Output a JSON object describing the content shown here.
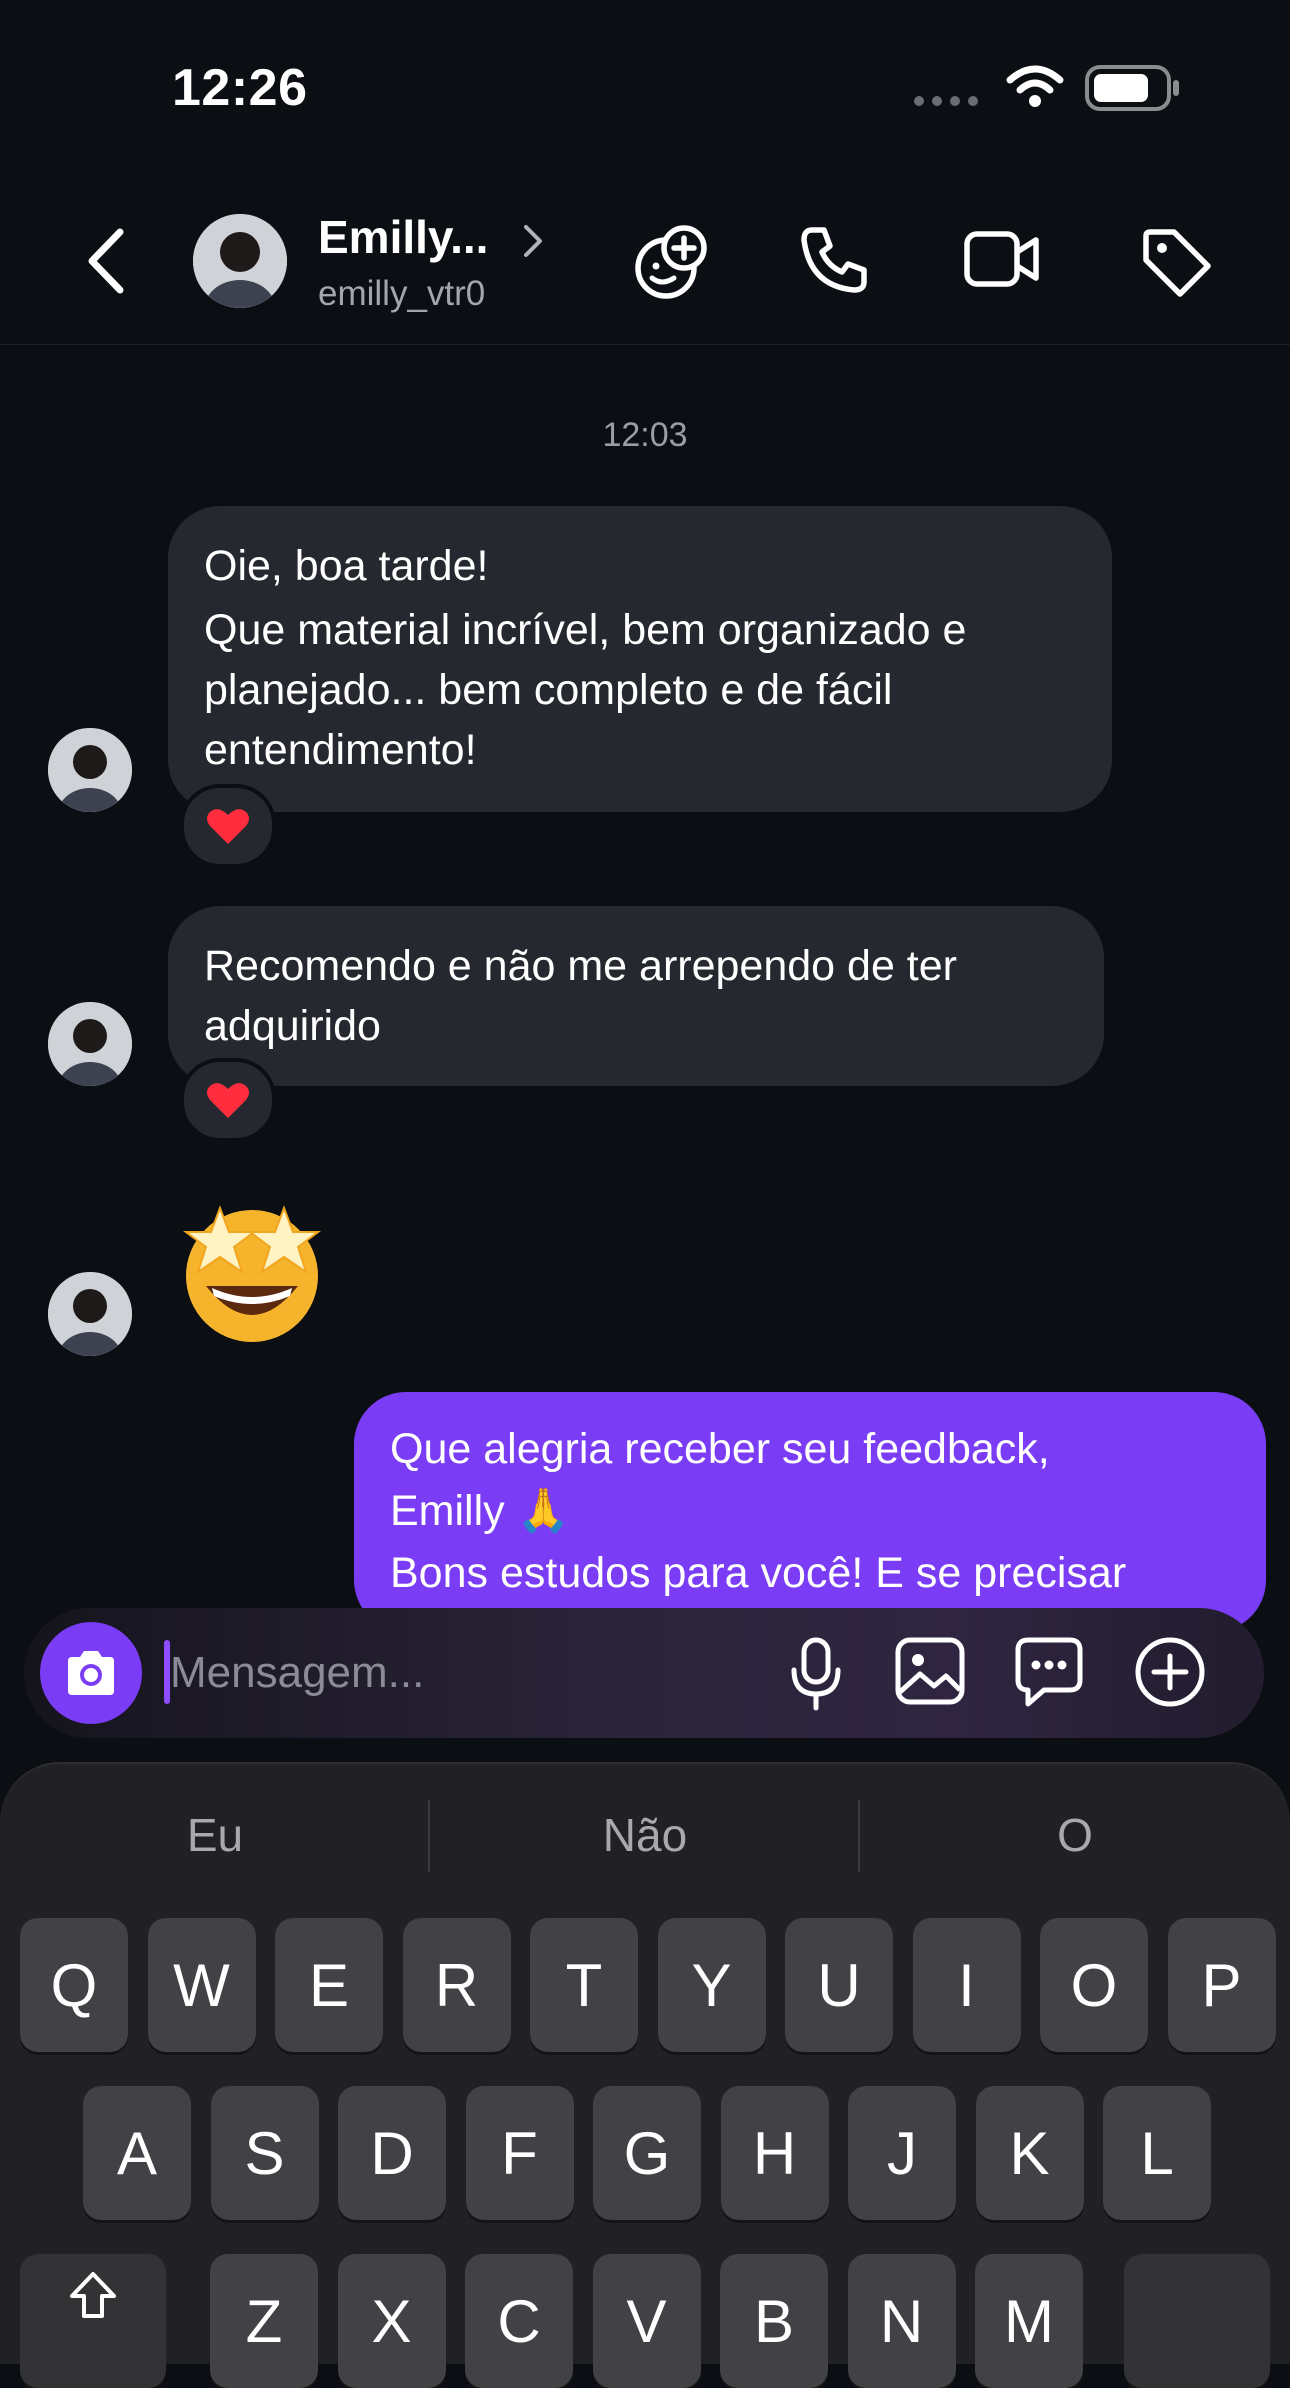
{
  "status_bar": {
    "time": "12:26"
  },
  "header": {
    "name": "Emilly...",
    "username": "emilly_vtr0",
    "icons": [
      "back-icon",
      "chevron-right-icon",
      "add-effect-icon",
      "phone-icon",
      "video-camera-icon",
      "tag-icon"
    ]
  },
  "conversation": {
    "timestamp": "12:03",
    "messages": [
      {
        "from": "contact",
        "lines": [
          "Oie, boa tarde!",
          "Que material incrível, bem organizado e",
          "planejado... bem completo e de fácil",
          "entendimento!"
        ],
        "reaction": "❤️"
      },
      {
        "from": "contact",
        "lines": [
          "Recomendo e não me arrependo de ter",
          "adquirido"
        ],
        "reaction": "❤️"
      },
      {
        "from": "contact",
        "emoji": "🤩"
      },
      {
        "from": "me",
        "lines": [
          "Que alegria receber seu feedback,",
          "Emilly 🙏",
          "Bons estudos para você! E se precisar"
        ]
      }
    ]
  },
  "composer": {
    "placeholder": "Mensagem...",
    "icons": [
      "camera-icon",
      "microphone-icon",
      "gallery-icon",
      "sticker-icon",
      "plus-icon"
    ]
  },
  "keyboard": {
    "suggestions": [
      "Eu",
      "Não",
      "O"
    ],
    "row1": [
      "Q",
      "W",
      "E",
      "R",
      "T",
      "Y",
      "U",
      "I",
      "O",
      "P"
    ],
    "row2": [
      "A",
      "S",
      "D",
      "F",
      "G",
      "H",
      "J",
      "K",
      "L"
    ],
    "row3": [
      "Z",
      "X",
      "C",
      "V",
      "B",
      "N",
      "M"
    ]
  },
  "colors": {
    "background": "#0b0e13",
    "incoming_bubble": "#25282e",
    "outgoing_bubble": "#7a3cf5",
    "accent": "#7a3cf5",
    "keyboard": "#212124",
    "key": "#424246"
  }
}
